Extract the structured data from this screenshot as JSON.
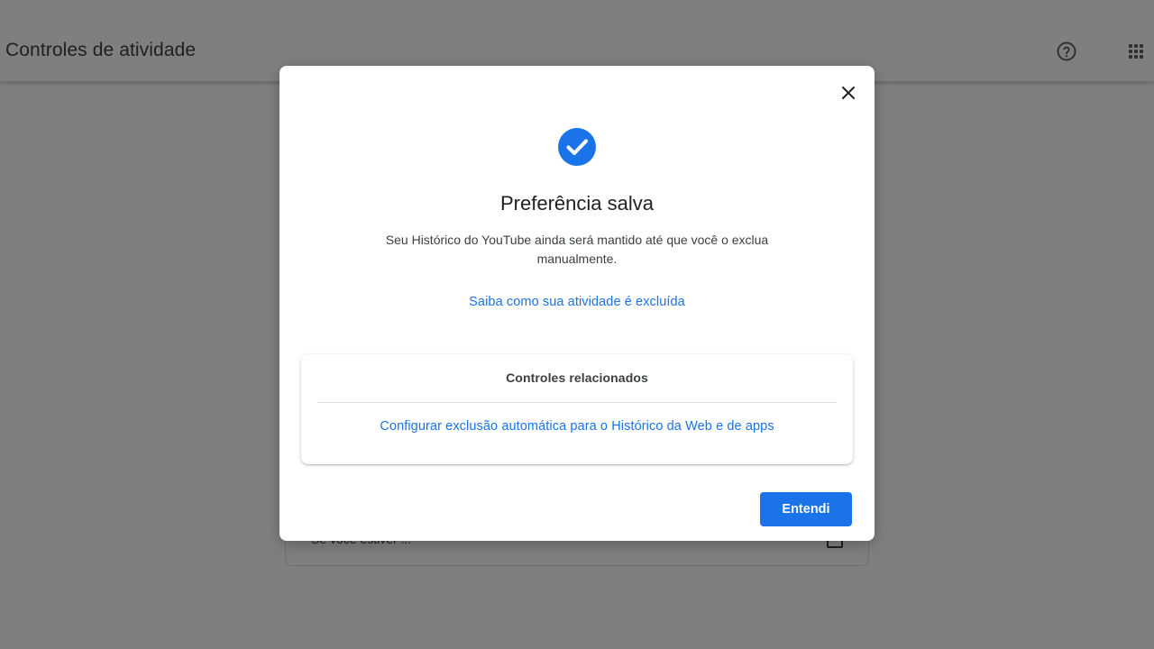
{
  "header": {
    "title": "Controles de atividade",
    "help_icon": "help-circle-icon",
    "apps_icon": "apps-grid-icon"
  },
  "background_card": {
    "text": "Se você estiver ...",
    "icon": "calendar-icon"
  },
  "dialog": {
    "close_icon": "close-icon",
    "status_icon": "check-circle-icon",
    "title": "Preferência salva",
    "body": "Seu Histórico do YouTube ainda será mantido até que você o exclua manualmente.",
    "learn_link": "Saiba como sua atividade é excluída",
    "related": {
      "title": "Controles relacionados",
      "link": "Configurar exclusão automática para o Histórico da Web e de apps"
    },
    "confirm_label": "Entendi"
  },
  "colors": {
    "accent": "#1a73e8",
    "scrim": "rgba(0,0,0,0.5)",
    "text_primary": "#202124",
    "text_secondary": "#3c4043"
  }
}
